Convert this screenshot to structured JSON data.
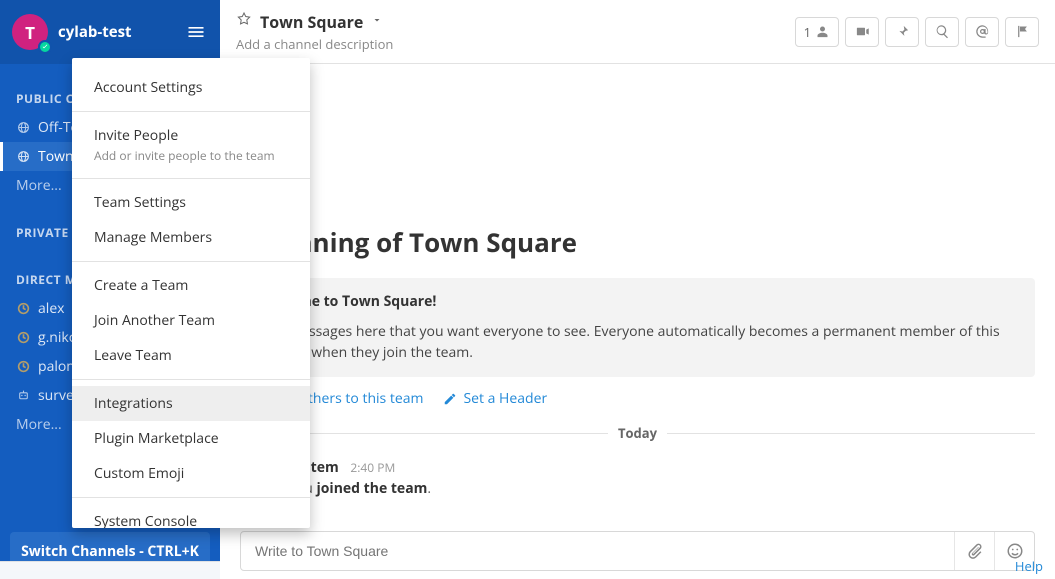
{
  "team": {
    "name": "cylab-test",
    "initial": "T"
  },
  "sidebar": {
    "sections": {
      "public": "PUBLIC CHANNELS",
      "private": "PRIVATE CHANNELS",
      "direct": "DIRECT MESSAGES"
    },
    "public_items": [
      "Off-Topic",
      "Town Square"
    ],
    "more": "More...",
    "direct_items": [
      "alex",
      "g.nikolaidis",
      "palomo",
      "surveybot"
    ],
    "switch": "Switch Channels - CTRL+K"
  },
  "menu": {
    "account": "Account Settings",
    "invite": "Invite People",
    "invite_sub": "Add or invite people to the team",
    "team_settings": "Team Settings",
    "manage_members": "Manage Members",
    "create_team": "Create a Team",
    "join_team": "Join Another Team",
    "leave_team": "Leave Team",
    "integrations": "Integrations",
    "plugin_marketplace": "Plugin Marketplace",
    "custom_emoji": "Custom Emoji",
    "system_console": "System Console"
  },
  "channel": {
    "title": "Town Square",
    "desc": "Add a channel description",
    "member_count": "1"
  },
  "intro": {
    "heading": "Beginning of Town Square",
    "welcome_title": "Welcome to Town Square!",
    "welcome_body": "Post messages here that you want everyone to see. Everyone automatically becomes a permanent member of this channel when they join the team.",
    "invite_link": "Invite others to this team",
    "header_link": "Set a Header"
  },
  "timeline": {
    "today": "Today",
    "post": {
      "author": "System",
      "time": "2:40 PM",
      "prefix": "You ",
      "bold": "joined the team",
      "suffix": "."
    }
  },
  "composer": {
    "placeholder": "Write to Town Square"
  },
  "footer": {
    "help": "Help"
  }
}
